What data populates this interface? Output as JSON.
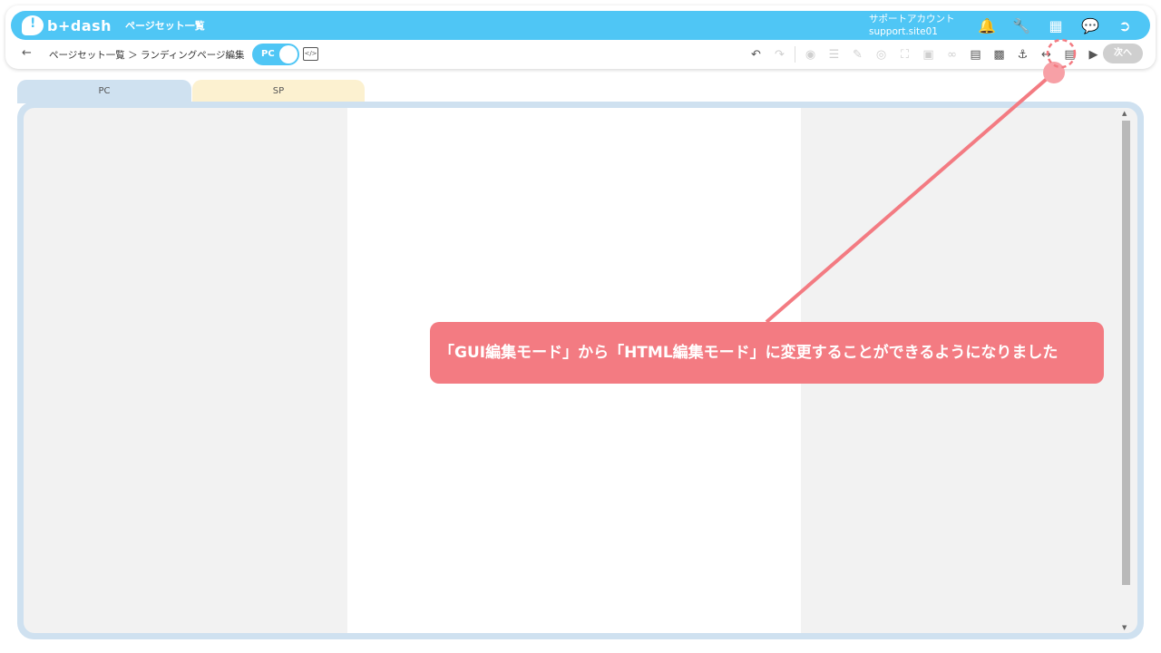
{
  "app": {
    "brand": "b+dash",
    "title": "ページセット一覧"
  },
  "account": {
    "name": "サポートアカウント",
    "id": "support.site01"
  },
  "header_icons": [
    "bell-icon",
    "wrench-icon",
    "grid-icon",
    "chat-icon",
    "logout-icon"
  ],
  "subbar": {
    "back": "←",
    "breadcrumb": "ページセット一覧 ＞ ランディングページ編集",
    "toggle_label": "PC",
    "code_glyph": "</>",
    "next_label": "次へ"
  },
  "tabs": [
    {
      "label": "PC",
      "color": "#cfe1f0"
    },
    {
      "label": "SP",
      "color": "#fcf1d0"
    }
  ],
  "callout": {
    "text": "「GUI編集モード」から「HTML編集モード」に変更することができるようになりました"
  },
  "colors": {
    "accent": "#4fc6f5",
    "callout": "#f37b82",
    "next_disabled": "#cfcfcf"
  }
}
